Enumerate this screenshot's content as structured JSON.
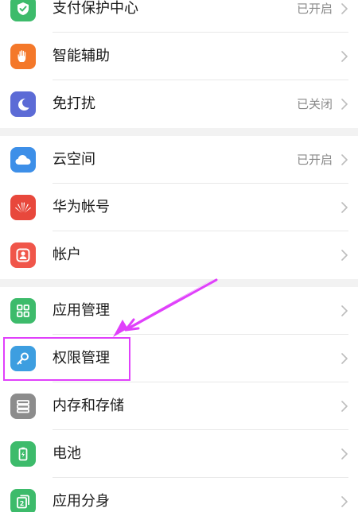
{
  "colors": {
    "background": "#ffffff",
    "separator": "#f2f2f2",
    "text_primary": "#1a1a1a",
    "text_secondary": "#8a8a8a",
    "chevron": "#bdbdbd",
    "annotation": "#e040fb"
  },
  "groups": [
    {
      "items": [
        {
          "label": "支付保护中心",
          "status": "已开启",
          "icon": "shield-check-icon",
          "icon_color": "#3dbb6b"
        },
        {
          "label": "智能辅助",
          "status": "",
          "icon": "hand-icon",
          "icon_color": "#f4782a"
        },
        {
          "label": "免打扰",
          "status": "已关闭",
          "icon": "moon-icon",
          "icon_color": "#5c6bd6"
        }
      ]
    },
    {
      "items": [
        {
          "label": "云空间",
          "status": "已开启",
          "icon": "cloud-icon",
          "icon_color": "#3d8fe8"
        },
        {
          "label": "华为帐号",
          "status": "",
          "icon": "huawei-logo-icon",
          "icon_color": "#e8483c"
        },
        {
          "label": "帐户",
          "status": "",
          "icon": "user-icon",
          "icon_color": "#f0564a"
        }
      ]
    },
    {
      "items": [
        {
          "label": "应用管理",
          "status": "",
          "icon": "grid-apps-icon",
          "icon_color": "#3dbb6b"
        },
        {
          "label": "权限管理",
          "status": "",
          "icon": "key-icon",
          "icon_color": "#3d9ee0"
        },
        {
          "label": "内存和存储",
          "status": "",
          "icon": "storage-icon",
          "icon_color": "#8c8c8c"
        },
        {
          "label": "电池",
          "status": "",
          "icon": "battery-icon",
          "icon_color": "#3dbb6b"
        },
        {
          "label": "应用分身",
          "status": "",
          "icon": "app-twin-icon",
          "icon_color": "#3dbb6b"
        }
      ]
    }
  ]
}
